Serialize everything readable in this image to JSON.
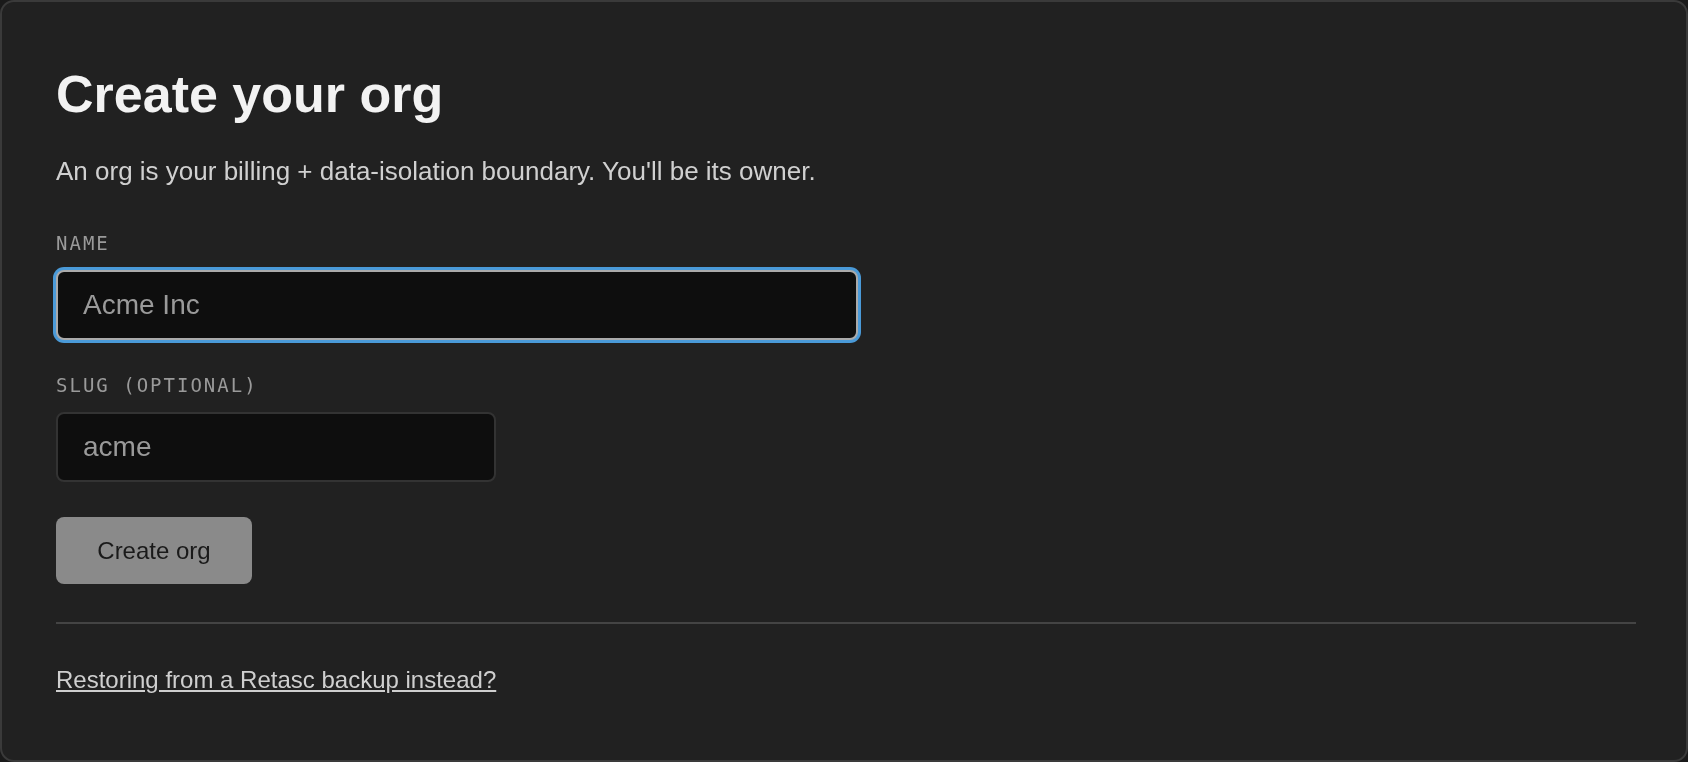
{
  "title": "Create your org",
  "subtitle": "An org is your billing + data-isolation boundary. You'll be its owner.",
  "fields": [
    {
      "label": "NAME",
      "placeholder": "Acme Inc",
      "focused": true,
      "kind": "wide"
    },
    {
      "label": "SLUG (OPTIONAL)",
      "placeholder": "acme",
      "focused": false,
      "kind": "narrow"
    }
  ],
  "submit_button": {
    "label": "Create org",
    "disabled": true
  },
  "restore_link": "Restoring from a Retasc backup instead?"
}
